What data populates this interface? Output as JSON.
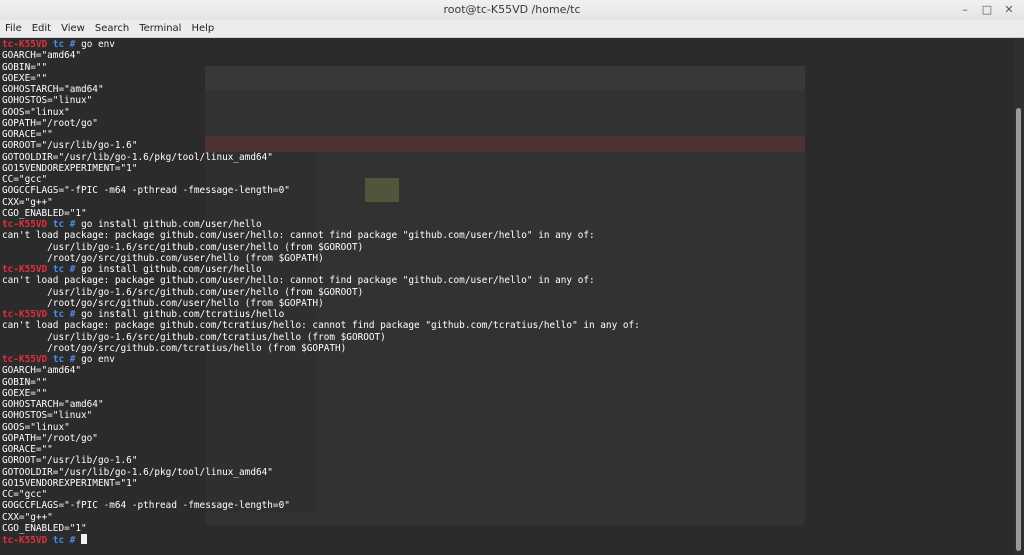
{
  "window": {
    "title": "root@tc-K55VD /home/tc",
    "controls": [
      "–",
      "□",
      "✕"
    ]
  },
  "menu": [
    "File",
    "Edit",
    "View",
    "Search",
    "Terminal",
    "Help"
  ],
  "terminal": {
    "prompt": {
      "host": "tc-K55VD",
      "dir": "tc",
      "symbol": "#"
    },
    "lines": [
      {
        "type": "prompt",
        "cmd": "go env"
      },
      {
        "type": "out",
        "text": "GOARCH=\"amd64\""
      },
      {
        "type": "out",
        "text": "GOBIN=\"\""
      },
      {
        "type": "out",
        "text": "GOEXE=\"\""
      },
      {
        "type": "out",
        "text": "GOHOSTARCH=\"amd64\""
      },
      {
        "type": "out",
        "text": "GOHOSTOS=\"linux\""
      },
      {
        "type": "out",
        "text": "GOOS=\"linux\""
      },
      {
        "type": "out",
        "text": "GOPATH=\"/root/go\""
      },
      {
        "type": "out",
        "text": "GORACE=\"\""
      },
      {
        "type": "out",
        "text": "GOROOT=\"/usr/lib/go-1.6\""
      },
      {
        "type": "out",
        "text": "GOTOOLDIR=\"/usr/lib/go-1.6/pkg/tool/linux_amd64\""
      },
      {
        "type": "out",
        "text": "GO15VENDOREXPERIMENT=\"1\""
      },
      {
        "type": "out",
        "text": "CC=\"gcc\""
      },
      {
        "type": "out",
        "text": "GOGCCFLAGS=\"-fPIC -m64 -pthread -fmessage-length=0\""
      },
      {
        "type": "out",
        "text": "CXX=\"g++\""
      },
      {
        "type": "out",
        "text": "CGO_ENABLED=\"1\""
      },
      {
        "type": "prompt",
        "cmd": "go install github.com/user/hello"
      },
      {
        "type": "out",
        "text": "can't load package: package github.com/user/hello: cannot find package \"github.com/user/hello\" in any of:"
      },
      {
        "type": "out",
        "text": "        /usr/lib/go-1.6/src/github.com/user/hello (from $GOROOT)"
      },
      {
        "type": "out",
        "text": "        /root/go/src/github.com/user/hello (from $GOPATH)"
      },
      {
        "type": "prompt",
        "cmd": "go install github.com/user/hello"
      },
      {
        "type": "out",
        "text": "can't load package: package github.com/user/hello: cannot find package \"github.com/user/hello\" in any of:"
      },
      {
        "type": "out",
        "text": "        /usr/lib/go-1.6/src/github.com/user/hello (from $GOROOT)"
      },
      {
        "type": "out",
        "text": "        /root/go/src/github.com/user/hello (from $GOPATH)"
      },
      {
        "type": "prompt",
        "cmd": "go install github.com/tcratius/hello"
      },
      {
        "type": "out",
        "text": "can't load package: package github.com/tcratius/hello: cannot find package \"github.com/tcratius/hello\" in any of:"
      },
      {
        "type": "out",
        "text": "        /usr/lib/go-1.6/src/github.com/tcratius/hello (from $GOROOT)"
      },
      {
        "type": "out",
        "text": "        /root/go/src/github.com/tcratius/hello (from $GOPATH)"
      },
      {
        "type": "prompt",
        "cmd": "go env"
      },
      {
        "type": "out",
        "text": "GOARCH=\"amd64\""
      },
      {
        "type": "out",
        "text": "GOBIN=\"\""
      },
      {
        "type": "out",
        "text": "GOEXE=\"\""
      },
      {
        "type": "out",
        "text": "GOHOSTARCH=\"amd64\""
      },
      {
        "type": "out",
        "text": "GOHOSTOS=\"linux\""
      },
      {
        "type": "out",
        "text": "GOOS=\"linux\""
      },
      {
        "type": "out",
        "text": "GOPATH=\"/root/go\""
      },
      {
        "type": "out",
        "text": "GORACE=\"\""
      },
      {
        "type": "out",
        "text": "GOROOT=\"/usr/lib/go-1.6\""
      },
      {
        "type": "out",
        "text": "GOTOOLDIR=\"/usr/lib/go-1.6/pkg/tool/linux_amd64\""
      },
      {
        "type": "out",
        "text": "GO15VENDOREXPERIMENT=\"1\""
      },
      {
        "type": "out",
        "text": "CC=\"gcc\""
      },
      {
        "type": "out",
        "text": "GOGCCFLAGS=\"-fPIC -m64 -pthread -fmessage-length=0\""
      },
      {
        "type": "out",
        "text": "CXX=\"g++\""
      },
      {
        "type": "out",
        "text": "CGO_ENABLED=\"1\""
      },
      {
        "type": "prompt",
        "cmd": "",
        "cursor": true
      }
    ]
  },
  "colors": {
    "background": "#2b2b2b",
    "host": "#e0303a",
    "dir": "#4c8be6",
    "text": "#ffffff"
  }
}
